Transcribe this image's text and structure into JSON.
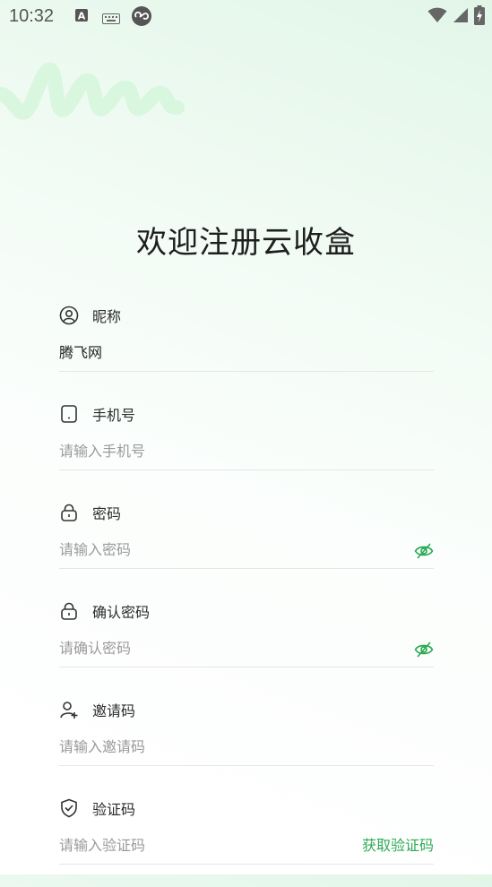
{
  "status_bar": {
    "time": "10:32",
    "icons": [
      "a-badge-icon",
      "keyboard-icon",
      "sync-icon",
      "wifi-icon",
      "signal-icon",
      "battery-charging-icon"
    ]
  },
  "page": {
    "title": "欢迎注册云收盒"
  },
  "form": {
    "fields": [
      {
        "label": "昵称",
        "icon": "user-circle-icon",
        "value": "腾飞网",
        "placeholder": ""
      },
      {
        "label": "手机号",
        "icon": "phone-icon",
        "value": "",
        "placeholder": "请输入手机号"
      },
      {
        "label": "密码",
        "icon": "lock-icon",
        "value": "",
        "placeholder": "请输入密码"
      },
      {
        "label": "确认密码",
        "icon": "lock-icon",
        "value": "",
        "placeholder": "请确认密码"
      },
      {
        "label": "邀请码",
        "icon": "user-add-icon",
        "value": "",
        "placeholder": "请输入邀请码"
      },
      {
        "label": "验证码",
        "icon": "shield-check-icon",
        "value": "",
        "placeholder": "请输入验证码"
      }
    ],
    "get_code_label": "获取验证码"
  },
  "colors": {
    "accent": "#2eaa55",
    "brush": "#d9f6de"
  }
}
